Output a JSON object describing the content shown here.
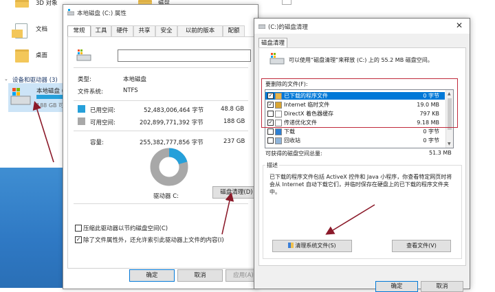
{
  "explorer": {
    "items": [
      {
        "label": "3D 对象"
      },
      {
        "label": "文档"
      },
      {
        "label": "桌面"
      }
    ],
    "top_item": "磁盘",
    "devices_header": "设备和驱动器 (3)",
    "drive": {
      "label": "本地磁盘 (",
      "free": "188 GB 可"
    }
  },
  "props": {
    "title": "本地磁盘 (C:) 属性",
    "tabs": [
      "常规",
      "工具",
      "硬件",
      "共享",
      "安全",
      "以前的版本",
      "配额"
    ],
    "type_label": "类型:",
    "type_value": "本地磁盘",
    "fs_label": "文件系统:",
    "fs_value": "NTFS",
    "used_label": "已用空间:",
    "used_bytes": "52,483,006,464 字节",
    "used_gb": "48.8 GB",
    "free_label": "可用空间:",
    "free_bytes": "202,899,771,392 字节",
    "free_gb": "188 GB",
    "cap_label": "容量:",
    "cap_bytes": "255,382,777,856 字节",
    "cap_gb": "237 GB",
    "used_fraction": 0.205,
    "drive_label": "驱动器 C:",
    "cleanup_button": "磁盘清理(D)",
    "compress_label": "压缩此驱动器以节约磁盘空间(C)",
    "index_label": "除了文件属性外，还允许索引此驱动器上文件的内容(I)",
    "ok": "确定",
    "cancel": "取消",
    "apply": "应用(A)",
    "colors": {
      "used": "#26a0da",
      "free": "#a8a8a8"
    }
  },
  "clean": {
    "title": "(C:)的磁盘清理",
    "tab": "磁盘清理",
    "intro": "可以使用“磁盘清理”来释放 (C:) 上的 55.2 MB 磁盘空间。",
    "files_header": "要删除的文件(F):",
    "files": [
      {
        "name": "已下载的程序文件",
        "size": "0 字节",
        "checked": true,
        "selected": true,
        "icon": "folder-icon"
      },
      {
        "name": "Internet 临时文件",
        "size": "19.0 MB",
        "checked": true,
        "selected": false,
        "icon": "lock-icon"
      },
      {
        "name": "DirectX 着色器缓存",
        "size": "797 KB",
        "checked": false,
        "selected": false,
        "icon": "file-icon"
      },
      {
        "name": "传递优化文件",
        "size": "9.18 MB",
        "checked": true,
        "selected": false,
        "icon": "file-icon"
      },
      {
        "name": "下载",
        "size": "0 字节",
        "checked": false,
        "selected": false,
        "icon": "download-icon"
      },
      {
        "name": "回收站",
        "size": "0 字节",
        "checked": false,
        "selected": false,
        "icon": "recycle-bin-icon"
      }
    ],
    "total_label": "可获得的磁盘空间总量:",
    "total_value": "51.3 MB",
    "desc_label": "描述",
    "desc_text": "已下载的程序文件包括 ActiveX 控件和 Java 小程序，你查看特定网页时将会从 Internet 自动下载它们，并临时保存在硬盘上的已下载的程序文件夹中。",
    "clean_sys_button": "清理系统文件(S)",
    "view_files_button": "查看文件(V)",
    "ok": "确定",
    "cancel": "取消"
  }
}
